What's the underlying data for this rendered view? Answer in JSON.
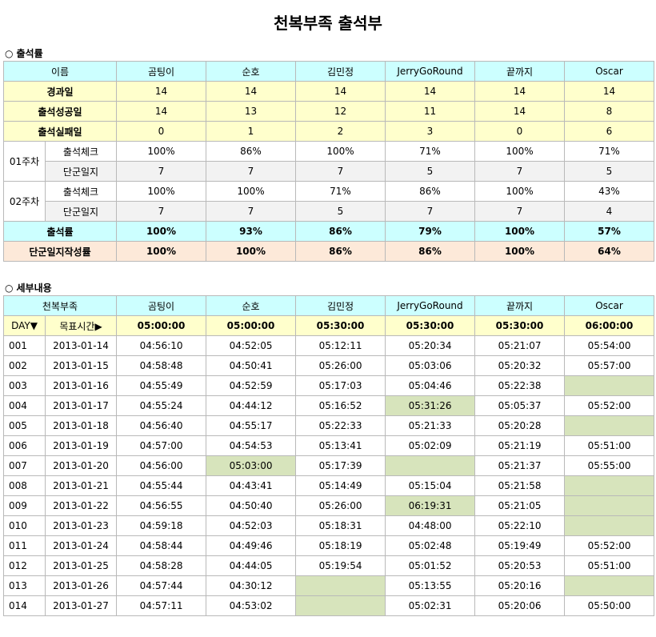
{
  "title": "천복부족 출석부",
  "summary": {
    "heading": "출석률",
    "name_header": "이름",
    "members": [
      "곰팅이",
      "순호",
      "김민정",
      "JerryGoRound",
      "끝까지",
      "Oscar"
    ],
    "rows": [
      {
        "label": "경과일",
        "values": [
          "14",
          "14",
          "14",
          "14",
          "14",
          "14"
        ]
      },
      {
        "label": "출석성공일",
        "values": [
          "14",
          "13",
          "12",
          "11",
          "14",
          "8"
        ]
      },
      {
        "label": "출석실패일",
        "values": [
          "0",
          "1",
          "2",
          "3",
          "0",
          "6"
        ]
      }
    ],
    "weeks": [
      {
        "label": "01주차",
        "check_label": "출석체크",
        "check": [
          "100%",
          "86%",
          "100%",
          "71%",
          "100%",
          "71%"
        ],
        "diary_label": "단군일지",
        "diary": [
          "7",
          "7",
          "7",
          "5",
          "7",
          "5"
        ]
      },
      {
        "label": "02주차",
        "check_label": "출석체크",
        "check": [
          "100%",
          "100%",
          "71%",
          "86%",
          "100%",
          "43%"
        ],
        "diary_label": "단군일지",
        "diary": [
          "7",
          "7",
          "5",
          "7",
          "7",
          "4"
        ]
      }
    ],
    "rate": {
      "label": "출석률",
      "values": [
        "100%",
        "93%",
        "86%",
        "79%",
        "100%",
        "57%"
      ]
    },
    "diary_rate": {
      "label": "단군일지작성률",
      "values": [
        "100%",
        "100%",
        "86%",
        "86%",
        "100%",
        "64%"
      ]
    }
  },
  "detail": {
    "heading": "세부내용",
    "tribe_header": "천복부족",
    "day_header": "DAY▼",
    "target_header": "목표시간▶",
    "targets": [
      "05:00:00",
      "05:00:00",
      "05:30:00",
      "05:30:00",
      "05:30:00",
      "06:00:00"
    ],
    "miss_color": "#d7e4bc",
    "rows": [
      {
        "day": "001",
        "date": "2013-01-14",
        "times": [
          "04:56:10",
          "04:52:05",
          "05:12:11",
          "05:20:34",
          "05:21:07",
          "05:54:00"
        ],
        "miss": [
          false,
          false,
          false,
          false,
          false,
          false
        ]
      },
      {
        "day": "002",
        "date": "2013-01-15",
        "times": [
          "04:58:48",
          "04:50:41",
          "05:26:00",
          "05:03:06",
          "05:20:32",
          "05:57:00"
        ],
        "miss": [
          false,
          false,
          false,
          false,
          false,
          false
        ]
      },
      {
        "day": "003",
        "date": "2013-01-16",
        "times": [
          "04:55:49",
          "04:52:59",
          "05:17:03",
          "05:04:46",
          "05:22:38",
          ""
        ],
        "miss": [
          false,
          false,
          false,
          false,
          false,
          true
        ]
      },
      {
        "day": "004",
        "date": "2013-01-17",
        "times": [
          "04:55:24",
          "04:44:12",
          "05:16:52",
          "05:31:26",
          "05:05:37",
          "05:52:00"
        ],
        "miss": [
          false,
          false,
          false,
          true,
          false,
          false
        ]
      },
      {
        "day": "005",
        "date": "2013-01-18",
        "times": [
          "04:56:40",
          "04:55:17",
          "05:22:33",
          "05:21:33",
          "05:20:28",
          ""
        ],
        "miss": [
          false,
          false,
          false,
          false,
          false,
          true
        ]
      },
      {
        "day": "006",
        "date": "2013-01-19",
        "times": [
          "04:57:00",
          "04:54:53",
          "05:13:41",
          "05:02:09",
          "05:21:19",
          "05:51:00"
        ],
        "miss": [
          false,
          false,
          false,
          false,
          false,
          false
        ]
      },
      {
        "day": "007",
        "date": "2013-01-20",
        "times": [
          "04:56:00",
          "05:03:00",
          "05:17:39",
          "",
          "05:21:37",
          "05:55:00"
        ],
        "miss": [
          false,
          true,
          false,
          true,
          false,
          false
        ]
      },
      {
        "day": "008",
        "date": "2013-01-21",
        "times": [
          "04:55:44",
          "04:43:41",
          "05:14:49",
          "05:15:04",
          "05:21:58",
          ""
        ],
        "miss": [
          false,
          false,
          false,
          false,
          false,
          true
        ]
      },
      {
        "day": "009",
        "date": "2013-01-22",
        "times": [
          "04:56:55",
          "04:50:40",
          "05:26:00",
          "06:19:31",
          "05:21:05",
          ""
        ],
        "miss": [
          false,
          false,
          false,
          true,
          false,
          true
        ]
      },
      {
        "day": "010",
        "date": "2013-01-23",
        "times": [
          "04:59:18",
          "04:52:03",
          "05:18:31",
          "04:48:00",
          "05:22:10",
          ""
        ],
        "miss": [
          false,
          false,
          false,
          false,
          false,
          true
        ]
      },
      {
        "day": "011",
        "date": "2013-01-24",
        "times": [
          "04:58:44",
          "04:49:46",
          "05:18:19",
          "05:02:48",
          "05:19:49",
          "05:52:00"
        ],
        "miss": [
          false,
          false,
          false,
          false,
          false,
          false
        ]
      },
      {
        "day": "012",
        "date": "2013-01-25",
        "times": [
          "04:58:28",
          "04:44:05",
          "05:19:54",
          "05:01:52",
          "05:20:53",
          "05:51:00"
        ],
        "miss": [
          false,
          false,
          false,
          false,
          false,
          false
        ]
      },
      {
        "day": "013",
        "date": "2013-01-26",
        "times": [
          "04:57:44",
          "04:30:12",
          "",
          "05:13:55",
          "05:20:16",
          ""
        ],
        "miss": [
          false,
          false,
          true,
          false,
          false,
          true
        ]
      },
      {
        "day": "014",
        "date": "2013-01-27",
        "times": [
          "04:57:11",
          "04:53:02",
          "",
          "05:02:31",
          "05:20:06",
          "05:50:00"
        ],
        "miss": [
          false,
          false,
          true,
          false,
          false,
          false
        ]
      }
    ]
  }
}
